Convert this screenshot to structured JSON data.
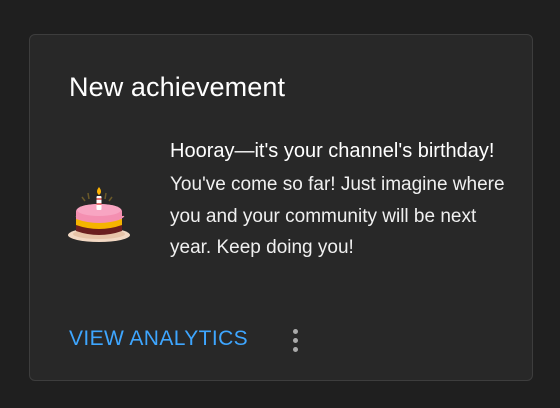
{
  "card": {
    "title": "New achievement",
    "headline": "Hooray—it's your channel's birthday!",
    "body": "You've come so far! Just imagine where you and your community will be next year. Keep doing you!",
    "illustration_icon": "birthday-cake-icon"
  },
  "actions": {
    "analytics_label": "VIEW ANALYTICS",
    "more_icon": "more-vert-icon"
  },
  "colors": {
    "page_background": "#1f1f1f",
    "card_background": "#282828",
    "link_blue": "#3ea6ff",
    "text_primary": "#ffffff"
  }
}
